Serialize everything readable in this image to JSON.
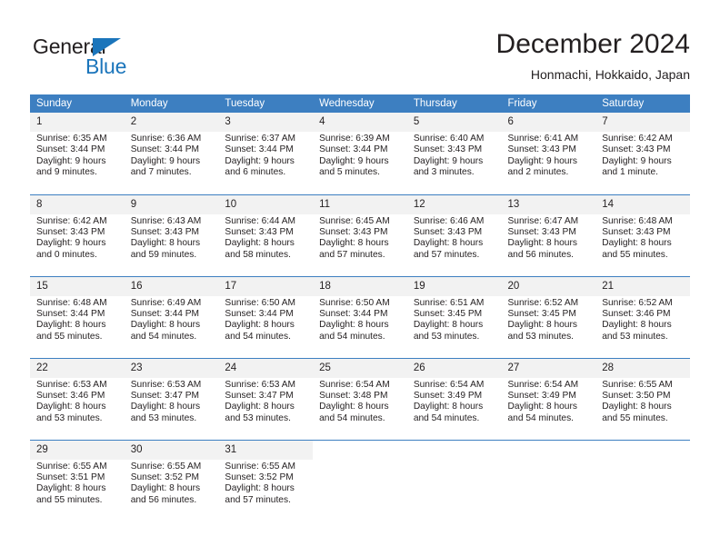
{
  "logo": {
    "text_primary": "General",
    "text_secondary": "Blue",
    "icon": "triangle-mark",
    "color_primary": "#231f20",
    "color_secondary": "#1b75bb"
  },
  "header": {
    "title": "December 2024",
    "subtitle": "Honmachi, Hokkaido, Japan"
  },
  "calendar": {
    "header_bg": "#3d7fc1",
    "daycell_bg": "#f2f2f2",
    "weekdays": [
      "Sunday",
      "Monday",
      "Tuesday",
      "Wednesday",
      "Thursday",
      "Friday",
      "Saturday"
    ],
    "weeks": [
      [
        {
          "day": "1",
          "sunrise": "Sunrise: 6:35 AM",
          "sunset": "Sunset: 3:44 PM",
          "daylight": "Daylight: 9 hours and 9 minutes."
        },
        {
          "day": "2",
          "sunrise": "Sunrise: 6:36 AM",
          "sunset": "Sunset: 3:44 PM",
          "daylight": "Daylight: 9 hours and 7 minutes."
        },
        {
          "day": "3",
          "sunrise": "Sunrise: 6:37 AM",
          "sunset": "Sunset: 3:44 PM",
          "daylight": "Daylight: 9 hours and 6 minutes."
        },
        {
          "day": "4",
          "sunrise": "Sunrise: 6:39 AM",
          "sunset": "Sunset: 3:44 PM",
          "daylight": "Daylight: 9 hours and 5 minutes."
        },
        {
          "day": "5",
          "sunrise": "Sunrise: 6:40 AM",
          "sunset": "Sunset: 3:43 PM",
          "daylight": "Daylight: 9 hours and 3 minutes."
        },
        {
          "day": "6",
          "sunrise": "Sunrise: 6:41 AM",
          "sunset": "Sunset: 3:43 PM",
          "daylight": "Daylight: 9 hours and 2 minutes."
        },
        {
          "day": "7",
          "sunrise": "Sunrise: 6:42 AM",
          "sunset": "Sunset: 3:43 PM",
          "daylight": "Daylight: 9 hours and 1 minute."
        }
      ],
      [
        {
          "day": "8",
          "sunrise": "Sunrise: 6:42 AM",
          "sunset": "Sunset: 3:43 PM",
          "daylight": "Daylight: 9 hours and 0 minutes."
        },
        {
          "day": "9",
          "sunrise": "Sunrise: 6:43 AM",
          "sunset": "Sunset: 3:43 PM",
          "daylight": "Daylight: 8 hours and 59 minutes."
        },
        {
          "day": "10",
          "sunrise": "Sunrise: 6:44 AM",
          "sunset": "Sunset: 3:43 PM",
          "daylight": "Daylight: 8 hours and 58 minutes."
        },
        {
          "day": "11",
          "sunrise": "Sunrise: 6:45 AM",
          "sunset": "Sunset: 3:43 PM",
          "daylight": "Daylight: 8 hours and 57 minutes."
        },
        {
          "day": "12",
          "sunrise": "Sunrise: 6:46 AM",
          "sunset": "Sunset: 3:43 PM",
          "daylight": "Daylight: 8 hours and 57 minutes."
        },
        {
          "day": "13",
          "sunrise": "Sunrise: 6:47 AM",
          "sunset": "Sunset: 3:43 PM",
          "daylight": "Daylight: 8 hours and 56 minutes."
        },
        {
          "day": "14",
          "sunrise": "Sunrise: 6:48 AM",
          "sunset": "Sunset: 3:43 PM",
          "daylight": "Daylight: 8 hours and 55 minutes."
        }
      ],
      [
        {
          "day": "15",
          "sunrise": "Sunrise: 6:48 AM",
          "sunset": "Sunset: 3:44 PM",
          "daylight": "Daylight: 8 hours and 55 minutes."
        },
        {
          "day": "16",
          "sunrise": "Sunrise: 6:49 AM",
          "sunset": "Sunset: 3:44 PM",
          "daylight": "Daylight: 8 hours and 54 minutes."
        },
        {
          "day": "17",
          "sunrise": "Sunrise: 6:50 AM",
          "sunset": "Sunset: 3:44 PM",
          "daylight": "Daylight: 8 hours and 54 minutes."
        },
        {
          "day": "18",
          "sunrise": "Sunrise: 6:50 AM",
          "sunset": "Sunset: 3:44 PM",
          "daylight": "Daylight: 8 hours and 54 minutes."
        },
        {
          "day": "19",
          "sunrise": "Sunrise: 6:51 AM",
          "sunset": "Sunset: 3:45 PM",
          "daylight": "Daylight: 8 hours and 53 minutes."
        },
        {
          "day": "20",
          "sunrise": "Sunrise: 6:52 AM",
          "sunset": "Sunset: 3:45 PM",
          "daylight": "Daylight: 8 hours and 53 minutes."
        },
        {
          "day": "21",
          "sunrise": "Sunrise: 6:52 AM",
          "sunset": "Sunset: 3:46 PM",
          "daylight": "Daylight: 8 hours and 53 minutes."
        }
      ],
      [
        {
          "day": "22",
          "sunrise": "Sunrise: 6:53 AM",
          "sunset": "Sunset: 3:46 PM",
          "daylight": "Daylight: 8 hours and 53 minutes."
        },
        {
          "day": "23",
          "sunrise": "Sunrise: 6:53 AM",
          "sunset": "Sunset: 3:47 PM",
          "daylight": "Daylight: 8 hours and 53 minutes."
        },
        {
          "day": "24",
          "sunrise": "Sunrise: 6:53 AM",
          "sunset": "Sunset: 3:47 PM",
          "daylight": "Daylight: 8 hours and 53 minutes."
        },
        {
          "day": "25",
          "sunrise": "Sunrise: 6:54 AM",
          "sunset": "Sunset: 3:48 PM",
          "daylight": "Daylight: 8 hours and 54 minutes."
        },
        {
          "day": "26",
          "sunrise": "Sunrise: 6:54 AM",
          "sunset": "Sunset: 3:49 PM",
          "daylight": "Daylight: 8 hours and 54 minutes."
        },
        {
          "day": "27",
          "sunrise": "Sunrise: 6:54 AM",
          "sunset": "Sunset: 3:49 PM",
          "daylight": "Daylight: 8 hours and 54 minutes."
        },
        {
          "day": "28",
          "sunrise": "Sunrise: 6:55 AM",
          "sunset": "Sunset: 3:50 PM",
          "daylight": "Daylight: 8 hours and 55 minutes."
        }
      ],
      [
        {
          "day": "29",
          "sunrise": "Sunrise: 6:55 AM",
          "sunset": "Sunset: 3:51 PM",
          "daylight": "Daylight: 8 hours and 55 minutes."
        },
        {
          "day": "30",
          "sunrise": "Sunrise: 6:55 AM",
          "sunset": "Sunset: 3:52 PM",
          "daylight": "Daylight: 8 hours and 56 minutes."
        },
        {
          "day": "31",
          "sunrise": "Sunrise: 6:55 AM",
          "sunset": "Sunset: 3:52 PM",
          "daylight": "Daylight: 8 hours and 57 minutes."
        },
        {
          "day": "",
          "sunrise": "",
          "sunset": "",
          "daylight": ""
        },
        {
          "day": "",
          "sunrise": "",
          "sunset": "",
          "daylight": ""
        },
        {
          "day": "",
          "sunrise": "",
          "sunset": "",
          "daylight": ""
        },
        {
          "day": "",
          "sunrise": "",
          "sunset": "",
          "daylight": ""
        }
      ]
    ]
  }
}
